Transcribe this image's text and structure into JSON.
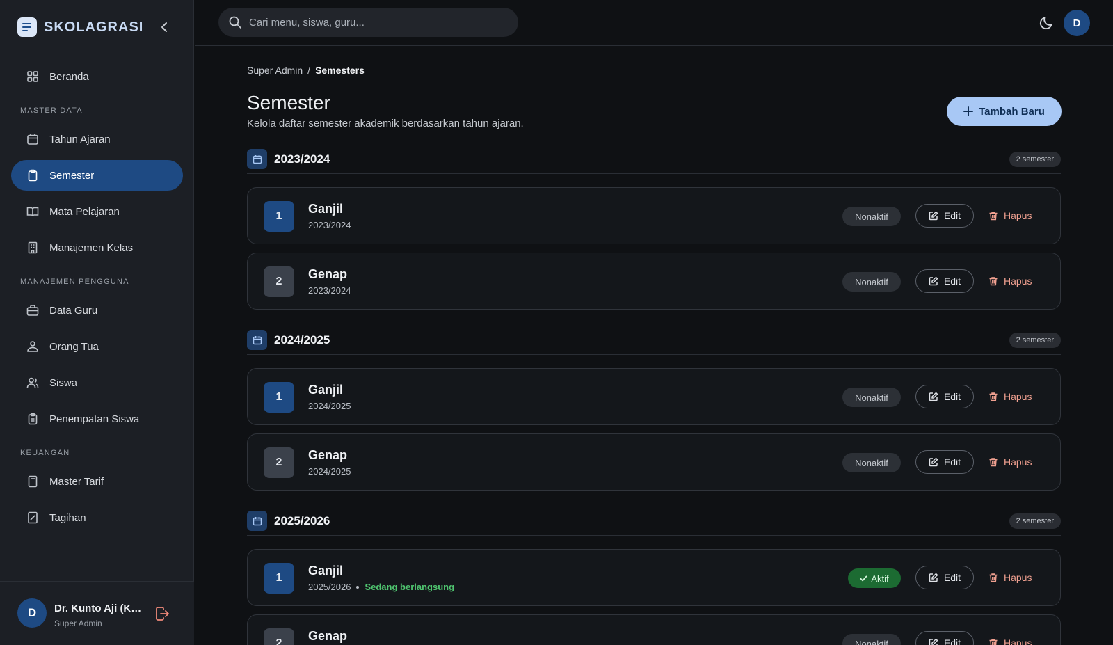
{
  "brand": {
    "name": "SKOLAGRASI"
  },
  "search": {
    "placeholder": "Cari menu, siswa, guru..."
  },
  "topbar": {
    "avatar_initial": "D"
  },
  "sidebar": {
    "home": "Beranda",
    "sections": [
      {
        "label": "MASTER DATA",
        "items": [
          "Tahun Ajaran",
          "Semester",
          "Mata Pelajaran",
          "Manajemen Kelas"
        ]
      },
      {
        "label": "MANAJEMEN PENGGUNA",
        "items": [
          "Data Guru",
          "Orang Tua",
          "Siswa",
          "Penempatan Siswa"
        ]
      },
      {
        "label": "KEUANGAN",
        "items": [
          "Master Tarif",
          "Tagihan"
        ]
      }
    ],
    "active_item": "Semester"
  },
  "user": {
    "initial": "D",
    "name": "Dr. Kunto Aji (Kepala Sekolah)",
    "role": "Super Admin"
  },
  "breadcrumb": {
    "root": "Super Admin",
    "separator": "/",
    "current": "Semesters"
  },
  "page": {
    "title": "Semester",
    "subtitle": "Kelola daftar semester akademik berdasarkan tahun ajaran.",
    "add_button": "Tambah Baru"
  },
  "actions": {
    "edit": "Edit",
    "delete": "Hapus"
  },
  "groups": [
    {
      "year": "2023/2024",
      "count": "2 semester",
      "semesters": [
        {
          "number": "1",
          "name": "Ganjil",
          "year": "2023/2024",
          "status": "Nonaktif",
          "active": false
        },
        {
          "number": "2",
          "name": "Genap",
          "year": "2023/2024",
          "status": "Nonaktif",
          "active": false
        }
      ]
    },
    {
      "year": "2024/2025",
      "count": "2 semester",
      "semesters": [
        {
          "number": "1",
          "name": "Ganjil",
          "year": "2024/2025",
          "status": "Nonaktif",
          "active": false
        },
        {
          "number": "2",
          "name": "Genap",
          "year": "2024/2025",
          "status": "Nonaktif",
          "active": false
        }
      ]
    },
    {
      "year": "2025/2026",
      "count": "2 semester",
      "semesters": [
        {
          "number": "1",
          "name": "Ganjil",
          "year": "2025/2026",
          "status": "Aktif",
          "active": true,
          "note": "Sedang berlangsung"
        },
        {
          "number": "2",
          "name": "Genap",
          "year": "",
          "status": "Nonaktif",
          "active": false
        }
      ]
    }
  ],
  "colors": {
    "accent": "#1e4a83",
    "primary_button": "#a8c8f5",
    "active_status": "#1c6b32",
    "danger": "#f0a090"
  }
}
